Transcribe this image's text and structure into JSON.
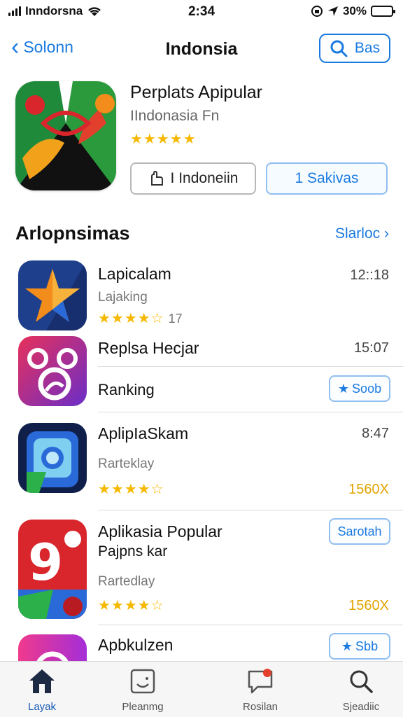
{
  "status_bar": {
    "carrier": "Inndorsna",
    "time": "2:34",
    "battery": "30%",
    "battery_level": 0.3,
    "icons": [
      "signal-icon",
      "wifi-icon",
      "lock-rotation-icon",
      "location-icon",
      "battery-icon"
    ]
  },
  "nav": {
    "back_label": "Solonn",
    "title": "Indonsia",
    "search_label": "Bas"
  },
  "featured": {
    "name": "Perplats Apipular",
    "subtitle": "IIndonasia Fn",
    "rating_stars": 5,
    "stars_text": "★★★★★",
    "button_primary": "I Indoneiin",
    "button_secondary": "1 Sakivas"
  },
  "section": {
    "title": "Arlopnsimas",
    "see_all": "Slarloc"
  },
  "apps": [
    {
      "title": "Lapicalam",
      "subtitle": "Lajaking",
      "stars_text": "★★★★☆",
      "rating": 3.5,
      "count": "17",
      "meta": "12::18"
    },
    {
      "title": "Replsa Hecjar",
      "subtitle": "Ranking",
      "meta": "15:07",
      "action": "Soob"
    },
    {
      "title": "AplipIaSkam",
      "subtitle": "Rarteklay",
      "stars_text": "★★★★☆",
      "rating": 4.5,
      "meta": "8:47",
      "meta2": "1560X"
    },
    {
      "title": "Aplikasia Popular",
      "title2": "Pajpns kar",
      "subtitle": "Rartedlay",
      "stars_text": "★★★★☆",
      "rating": 4.5,
      "meta2": "1560X",
      "action": "Sarotah"
    },
    {
      "title": "Apbkulzen",
      "action": "Sbb"
    }
  ],
  "tabs": [
    {
      "label": "Layak",
      "icon": "home-icon",
      "active": true
    },
    {
      "label": "Pleanmg",
      "icon": "gamepad-icon",
      "active": false
    },
    {
      "label": "Rosilan",
      "icon": "chat-icon",
      "active": false
    },
    {
      "label": "Sjeadiic",
      "icon": "search-icon",
      "active": false
    }
  ],
  "colors": {
    "accent": "#1a7ae0",
    "star": "#f6b800",
    "tab_active": "#1a5ab8"
  }
}
